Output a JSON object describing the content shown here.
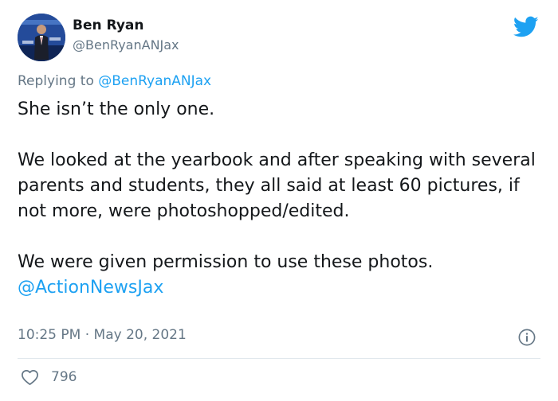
{
  "author": {
    "name": "Ben Ryan",
    "handle": "@BenRyanANJax",
    "avatar_icon": "profile-photo-news-anchor"
  },
  "reply": {
    "prefix": "Replying to",
    "mention": "@BenRyanANJax"
  },
  "tweet": {
    "line1": "She isn’t the only one.",
    "paragraph2": "We looked at the yearbook and after speaking with several parents and students, they all said at least 60 pictures, if not more, were photoshopped/edited.",
    "paragraph3": "We were given permission to use these photos.",
    "mention": "@ActionNewsJax"
  },
  "meta": {
    "time": "10:25 PM",
    "separator": "·",
    "date": "May 20, 2021"
  },
  "engagement": {
    "likes": "796"
  },
  "colors": {
    "twitter_blue": "#1da1f2",
    "secondary_text": "#657786",
    "primary_text": "#14171a"
  },
  "icons": {
    "brand": "twitter-bird-icon",
    "info": "info-icon",
    "like": "heart-icon"
  }
}
